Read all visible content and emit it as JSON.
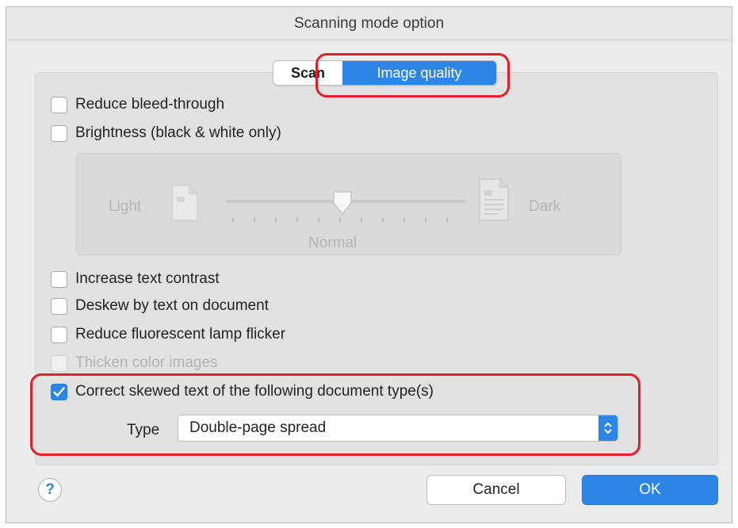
{
  "window": {
    "title": "Scanning mode option"
  },
  "tabs": [
    {
      "label": "Scan",
      "selected": false
    },
    {
      "label": "Image quality",
      "selected": true
    }
  ],
  "options": {
    "reduce_bleed": {
      "label": "Reduce bleed-through",
      "checked": false
    },
    "brightness": {
      "label": "Brightness (black & white only)",
      "checked": false
    },
    "increase_contrast": {
      "label": "Increase text contrast",
      "checked": false
    },
    "deskew": {
      "label": "Deskew by text on document",
      "checked": false
    },
    "reduce_flicker": {
      "label": "Reduce fluorescent lamp flicker",
      "checked": false
    },
    "thicken": {
      "label": "Thicken color images",
      "checked": false,
      "enabled": false
    },
    "correct_skew": {
      "label": "Correct skewed text of the following document type(s)",
      "checked": true
    }
  },
  "brightness_slider": {
    "light_label": "Light",
    "dark_label": "Dark",
    "normal_label": "Normal",
    "position": 0.5,
    "enabled": false
  },
  "type_select": {
    "label": "Type",
    "value": "Double-page spread"
  },
  "buttons": {
    "help": "?",
    "cancel": "Cancel",
    "ok": "OK"
  },
  "colors": {
    "accent": "#2d86e6",
    "highlight": "#e3202a"
  }
}
